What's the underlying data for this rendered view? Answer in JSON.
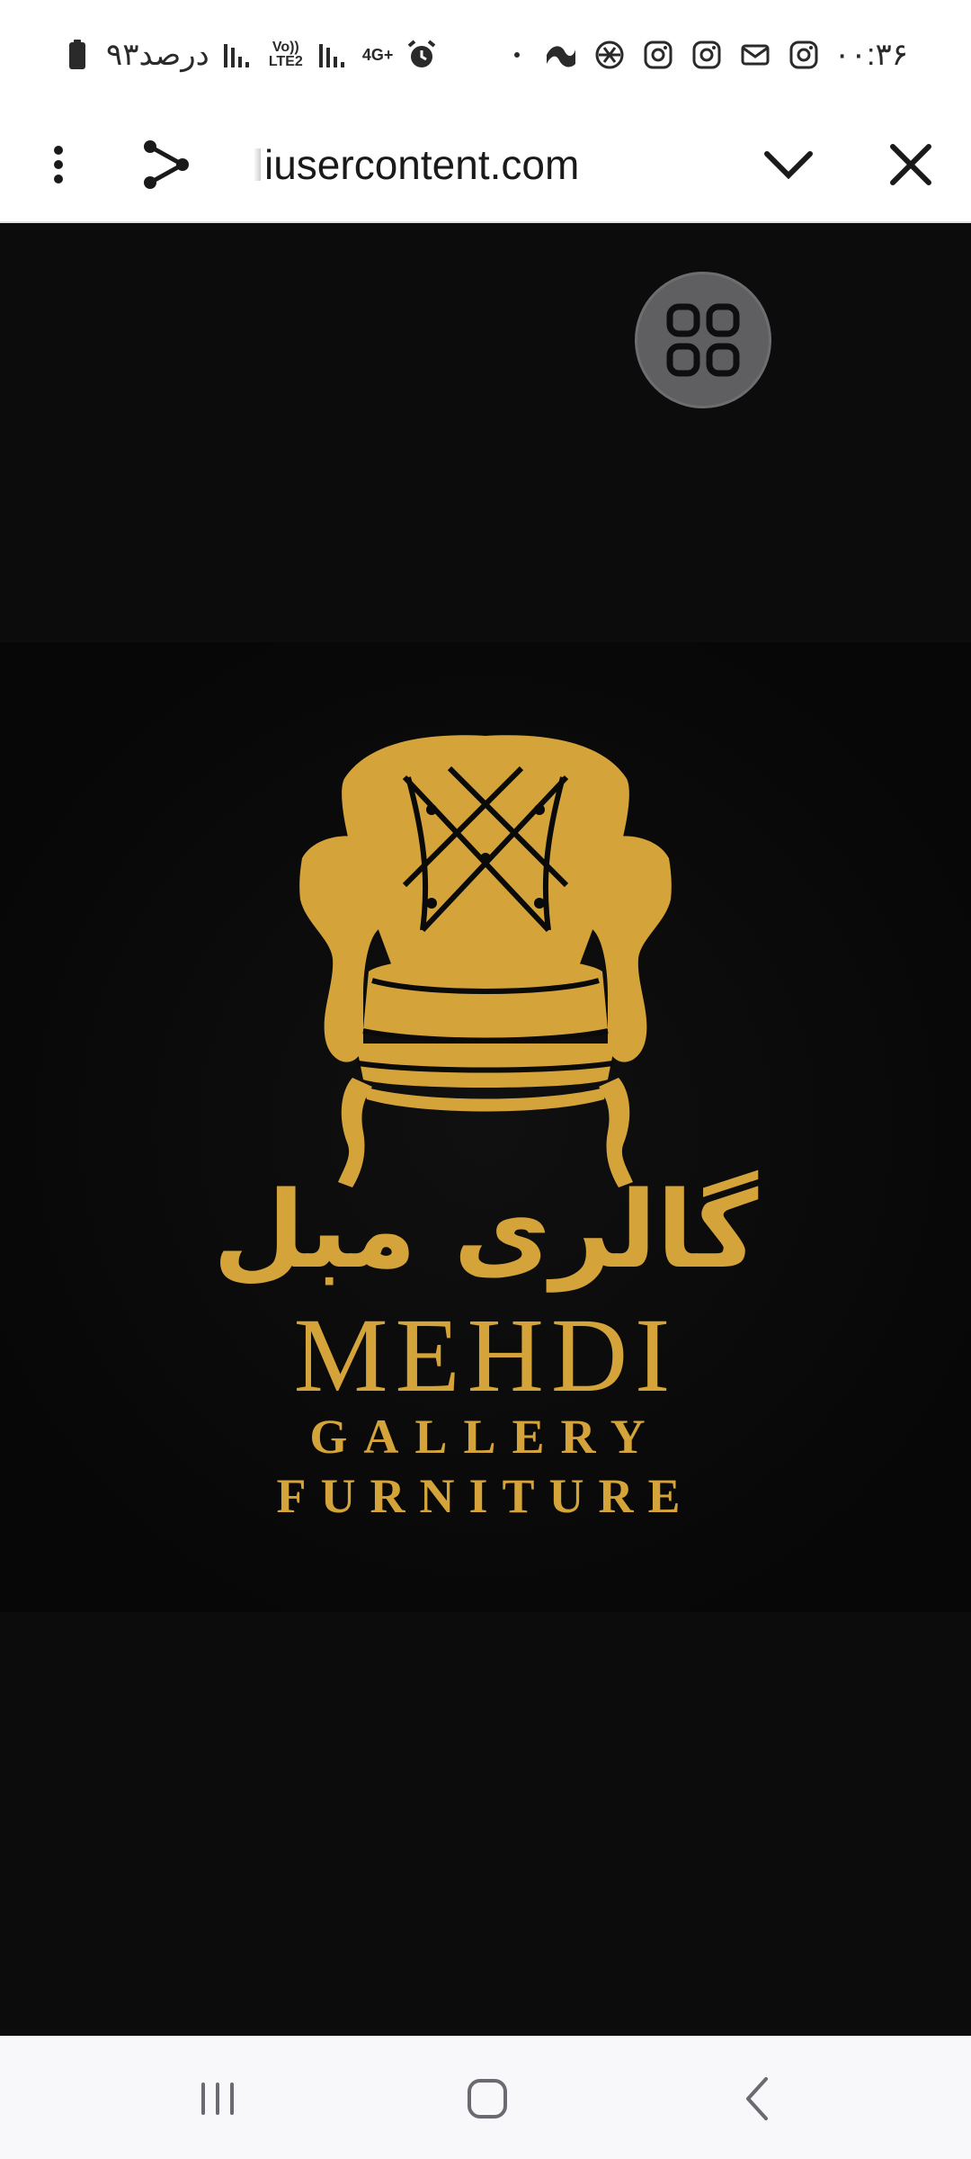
{
  "status_bar": {
    "battery_text": "۹۳درصد",
    "time": "۰۰:۳۶",
    "network_type": "4G+",
    "volte_label": "Vo)) LTE2",
    "left_icons": [
      "battery-icon",
      "signal-icon",
      "volte-icon",
      "signal-icon",
      "4g-icon",
      "alarm-icon"
    ],
    "right_icons": [
      "dot-icon",
      "app-icon",
      "chatgpt-icon",
      "instagram-icon",
      "instagram-icon",
      "mail-icon",
      "instagram-icon"
    ]
  },
  "toolbar": {
    "menu_icon": "more-vert-icon",
    "share_icon": "share-icon",
    "url": "iusercontent.com",
    "collapse_icon": "chevron-down-icon",
    "close_icon": "close-icon"
  },
  "content": {
    "floating_button_icon": "apps-grid-icon",
    "logo": {
      "text_arabic": "گالری مبل",
      "text_line1": "MEHDI",
      "text_line2": "GALLERY",
      "text_line3": "FURNITURE",
      "image": "armchair-logo",
      "gold_color": "#d4a43a",
      "background_color": "#080808"
    },
    "page_background": "#0c0c0d"
  },
  "nav_bar": {
    "recents_icon": "recents-icon",
    "home_icon": "home-icon",
    "back_icon": "back-icon"
  }
}
